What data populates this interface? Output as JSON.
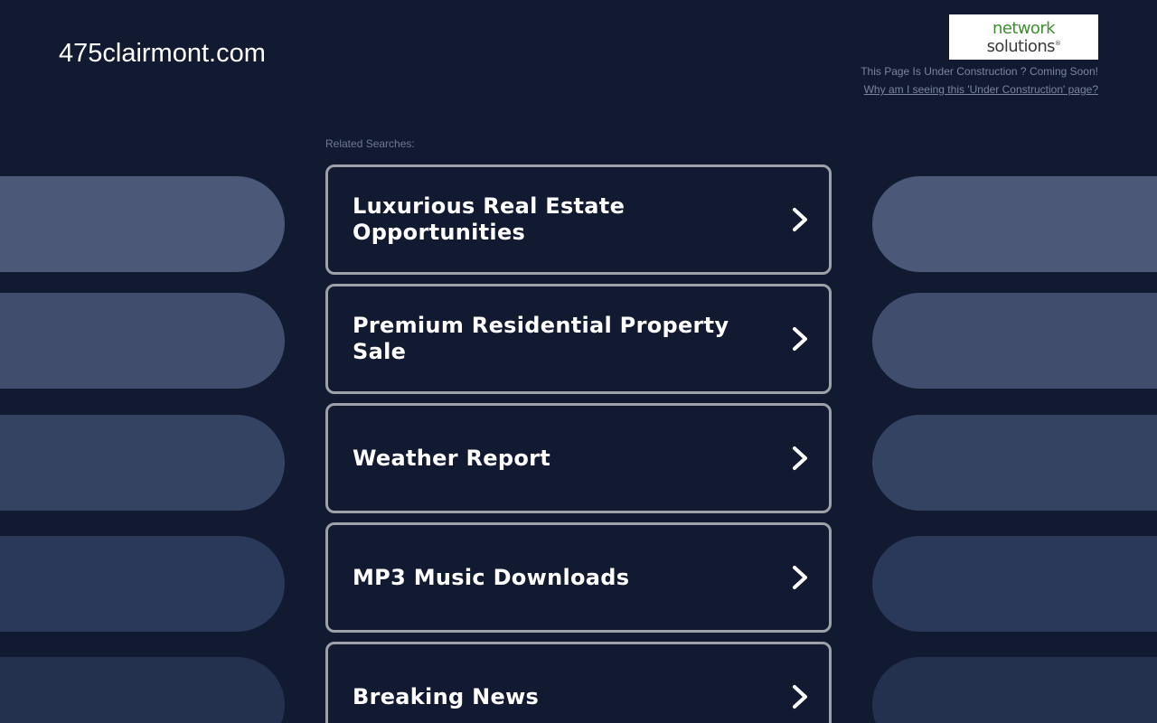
{
  "header": {
    "domain": "475clairmont.com",
    "logo": {
      "line1": "network",
      "line2": "solutions",
      "mark": "®"
    },
    "construction_text": "This Page Is Under Construction ? Coming Soon!",
    "why_link": "Why am I seeing this 'Under Construction' page?"
  },
  "related": {
    "label": "Related Searches:",
    "items": [
      {
        "label": "Luxurious Real Estate Opportunities"
      },
      {
        "label": "Premium Residential Property Sale"
      },
      {
        "label": "Weather Report"
      },
      {
        "label": "MP3 Music Downloads"
      },
      {
        "label": "Breaking News"
      }
    ]
  },
  "icons": {
    "result_arrow": "chevron-right-icon"
  },
  "colors": {
    "background": "#121a31",
    "result_border": "#9ea1a8",
    "logo_green": "#3d8f2f"
  }
}
